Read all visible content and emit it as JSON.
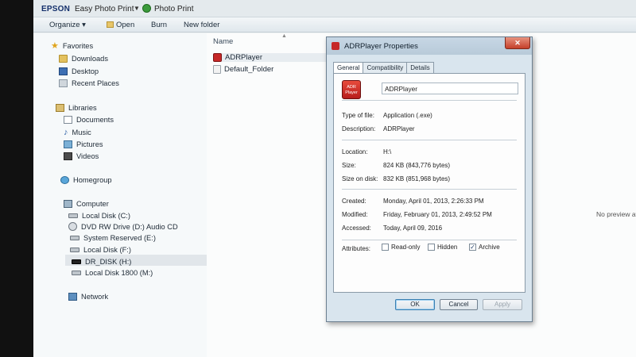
{
  "brand": {
    "epson": "EPSON",
    "easy_photo_print": "Easy Photo Print",
    "photo_print": "Photo Print"
  },
  "toolbar": {
    "organize": "Organize ▾",
    "open": "Open",
    "burn": "Burn",
    "new_folder": "New folder"
  },
  "nav": {
    "favorites": "Favorites",
    "downloads": "Downloads",
    "desktop": "Desktop",
    "recent_places": "Recent Places",
    "libraries": "Libraries",
    "documents": "Documents",
    "music": "Music",
    "pictures": "Pictures",
    "videos": "Videos",
    "homegroup": "Homegroup",
    "computer": "Computer",
    "drives": [
      "Local Disk (C:)",
      "DVD RW Drive (D:) Audio CD",
      "System Reserved (E:)",
      "Local Disk (F:)",
      "DR_DISK (H:)",
      "Local Disk 1800 (M:)"
    ],
    "network": "Network"
  },
  "files": {
    "column_name": "Name",
    "items": [
      "ADRPlayer",
      "Default_Folder"
    ],
    "no_preview": "No preview av"
  },
  "dialog": {
    "title": "ADRPlayer Properties",
    "close": "✕",
    "tabs": [
      "General",
      "Compatibility",
      "Details"
    ],
    "icon_text_1": "ADR",
    "icon_text_2": "Player",
    "name": "ADRPlayer",
    "rows": {
      "type_label": "Type of file:",
      "type_value": "Application (.exe)",
      "description_label": "Description:",
      "description_value": "ADRPlayer",
      "location_label": "Location:",
      "location_value": "H:\\",
      "size_label": "Size:",
      "size_value": "824 KB (843,776 bytes)",
      "size_on_disk_label": "Size on disk:",
      "size_on_disk_value": "832 KB (851,968 bytes)",
      "created_label": "Created:",
      "created_value": "Monday, April 01, 2013, 2:26:33 PM",
      "modified_label": "Modified:",
      "modified_value": "Friday, February 01, 2013, 2:49:52 PM",
      "accessed_label": "Accessed:",
      "accessed_value": "Today, April 09, 2016",
      "attributes_label": "Attributes:"
    },
    "attributes": {
      "read_only": "Read-only",
      "hidden": "Hidden",
      "archive": "Archive",
      "archive_checked": "✓"
    },
    "buttons": {
      "ok": "OK",
      "cancel": "Cancel",
      "apply": "Apply"
    }
  }
}
